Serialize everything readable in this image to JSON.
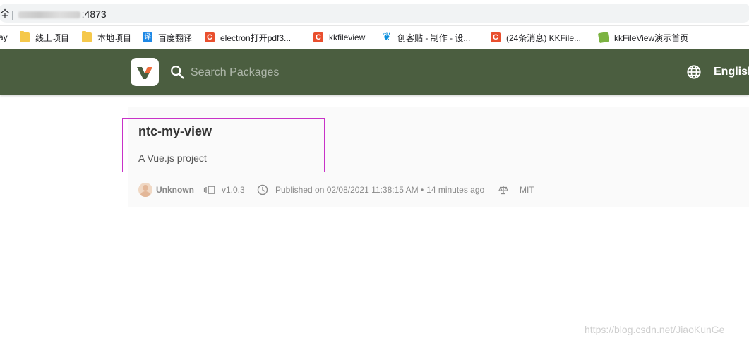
{
  "browser": {
    "address_prefix": "全",
    "address_suffix": ":4873"
  },
  "bookmarks": [
    {
      "label": "ay",
      "icon": "none"
    },
    {
      "label": "线上项目",
      "icon": "folder-icon"
    },
    {
      "label": "本地项目",
      "icon": "folder-icon"
    },
    {
      "label": "百度翻译",
      "icon": "translate-icon"
    },
    {
      "label": "electron打开pdf3...",
      "icon": "csdn-icon"
    },
    {
      "label": "kkfileview",
      "icon": "csdn-icon"
    },
    {
      "label": "创客贴 - 制作 - 设...",
      "icon": "chuangketie-icon"
    },
    {
      "label": "(24条消息) KKFile...",
      "icon": "csdn-icon"
    },
    {
      "label": "kkFileView演示首页",
      "icon": "leaf-icon"
    }
  ],
  "header": {
    "logo_icon": "verdaccio-logo-icon",
    "search_placeholder": "Search Packages",
    "language": "English",
    "background_color": "#4b5e40"
  },
  "package": {
    "name": "ntc-my-view",
    "description": "A Vue.js project",
    "author": "Unknown",
    "version": "v1.0.3",
    "published": "Published on 02/08/2021 11:38:15 AM •",
    "published_ago": "14 minutes ago",
    "license": "MIT"
  },
  "highlight_color": "#c832c8",
  "watermark": "https://blog.csdn.net/JiaoKunGe"
}
